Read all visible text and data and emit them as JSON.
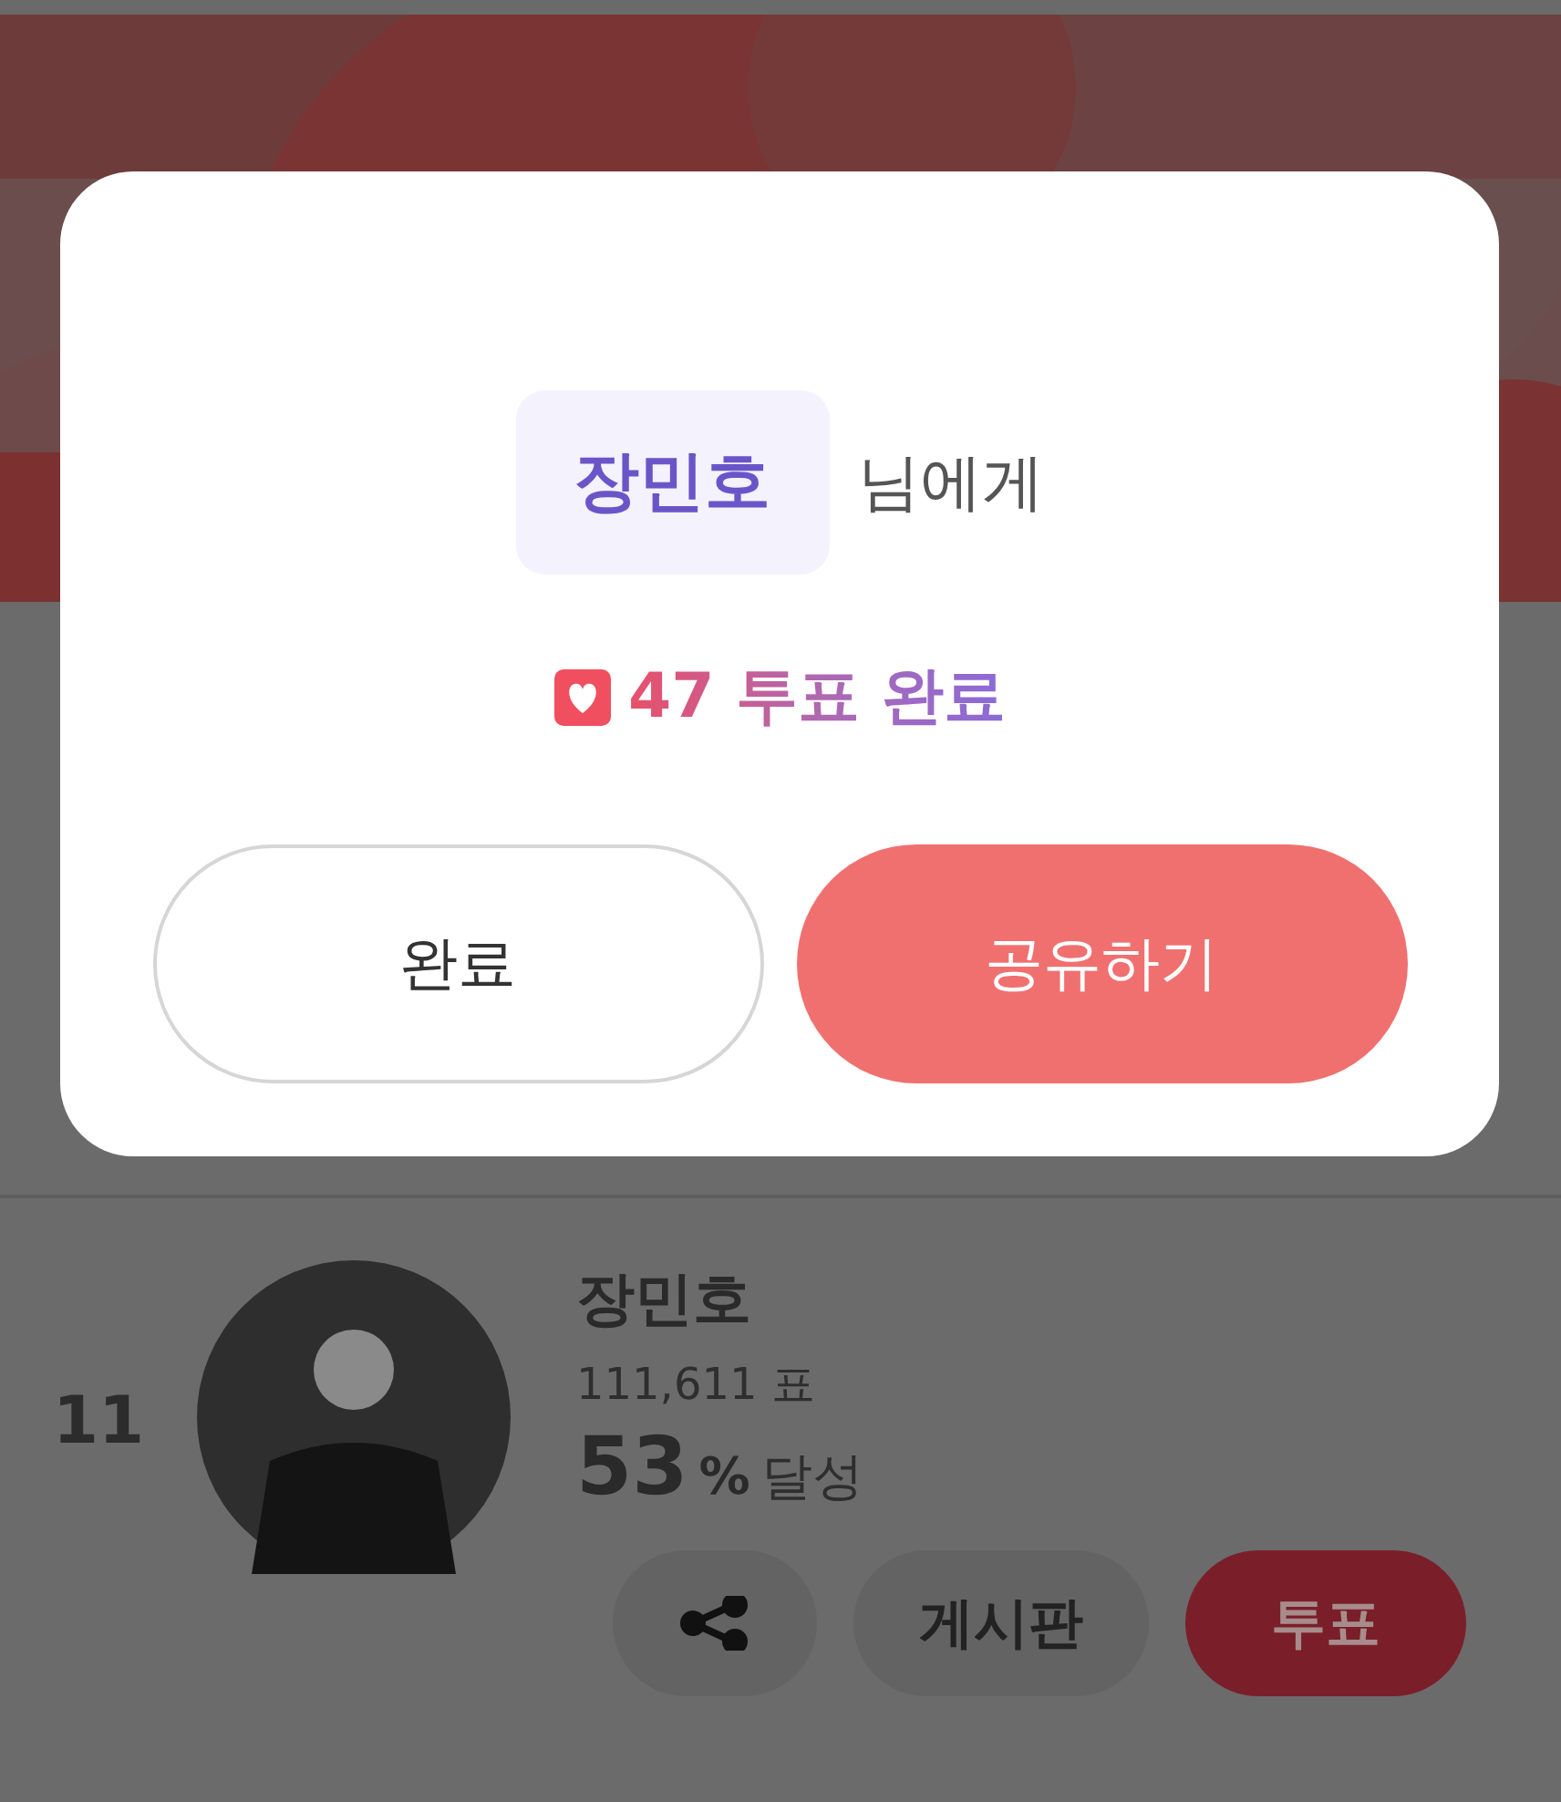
{
  "dialog": {
    "recipient": "장민호",
    "recipient_suffix": "님에게",
    "vote_result": "47 투표 완료",
    "buttons": [
      {
        "label": "완료",
        "kind": "outline"
      },
      {
        "label": "공유하기",
        "kind": "primary"
      }
    ]
  },
  "candidate": {
    "rank": "11",
    "name": "장민호",
    "votes": "111,611 표",
    "percent": "53",
    "percent_unit": "%",
    "percent_suffix": "달성",
    "actions": [
      {
        "kind": "share"
      },
      {
        "kind": "board",
        "label": "게시판"
      },
      {
        "kind": "vote",
        "label": "투표"
      }
    ]
  }
}
